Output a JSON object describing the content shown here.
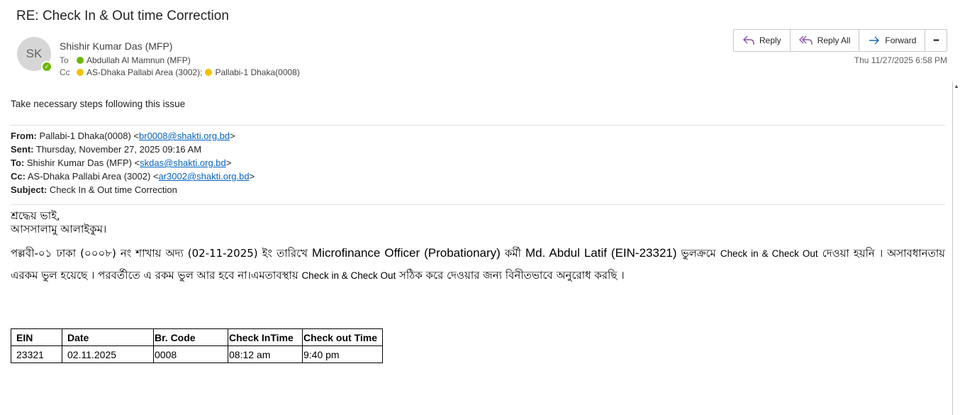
{
  "email": {
    "subject": "RE: Check In &  Out time Correction",
    "sender": {
      "initials": "SK",
      "name": "Shishir Kumar Das (MFP)"
    },
    "to_label": "To",
    "cc_label": "Cc",
    "to": [
      {
        "name": "Abdullah Al Mamnun (MFP)",
        "status": "green"
      }
    ],
    "cc": [
      {
        "name": "AS-Dhaka  Pallabi Area (3002);",
        "status": "yellow"
      },
      {
        "name": "Pallabi-1 Dhaka(0008)",
        "status": "yellow"
      }
    ],
    "date": "Thu 11/27/2025 6:58 PM"
  },
  "toolbar": {
    "reply": "Reply",
    "reply_all": "Reply All",
    "forward": "Forward",
    "more": "•••"
  },
  "colors": {
    "reply_icon": "#8a4fa8",
    "forward_icon": "#0f6cbd",
    "presence_available": "#6bb700",
    "presence_away": "#f2c200",
    "link": "#0563c1"
  },
  "body": {
    "intro": "Take necessary steps following this issue",
    "quoted": {
      "from_label": "From:",
      "from_text": " Pallabi-1 Dhaka(0008) <",
      "from_email": "br0008@shakti.org.bd",
      "from_end": ">",
      "sent_label": "Sent:",
      "sent_text": " Thursday, November 27, 2025 09:16 AM",
      "to_label": "To:",
      "to_text": " Shishir Kumar Das (MFP) <",
      "to_email": "skdas@shakti.org.bd",
      "to_end": ">",
      "cc_label": "Cc:",
      "cc_text": " AS-Dhaka Pallabi Area (3002) <",
      "cc_email": "ar3002@shakti.org.bd",
      "cc_end": ">",
      "subject_label": "Subject:",
      "subject_text": " Check In & Out time Correction"
    },
    "greeting1": "শ্রদ্ধেয় ভাই,",
    "greeting2": "আসসালামু আলাইকুম।",
    "para_a": "পল্লবী-০১ ঢাকা (০০০৮) নং  শাখায় অদ্য (02-11-2025) ইং তারিখে ",
    "para_b": "Microfinance Officer (Probationary)",
    "para_c": "  কর্মী ",
    "para_d": "Md. Abdul Latif (EIN-23321)",
    "para_e": " ভুলক্রমে ",
    "para_f": "Check in & Check Out",
    "para_g": " দেওয়া হয়নি । অসাবধানতায় এরকম ভুল হয়েছে । পরবর্তীতে এ রকম ভুল আর হবে না।এমতাবস্থায় ",
    "para_h": "Check in & Check Out",
    "para_i": " সঠিক করে দেওয়ার জন্য বিনীতভাবে অনুরোধ করছি ।"
  },
  "table": {
    "headers": [
      "EIN",
      "Date",
      "Br. Code",
      "Check InTime",
      "Check out Time"
    ],
    "rows": [
      [
        "23321",
        "02.11.2025",
        "0008",
        "08:12  am",
        "9:40  pm"
      ]
    ]
  }
}
